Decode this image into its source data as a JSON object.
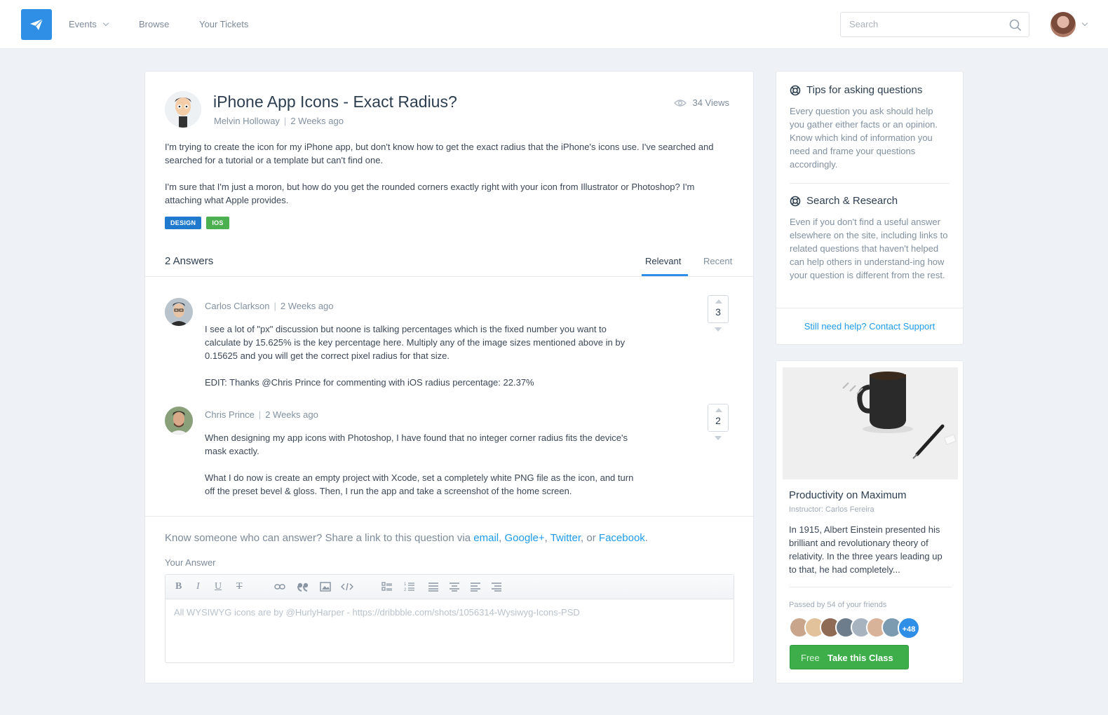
{
  "nav": {
    "events_label": "Events",
    "browse_label": "Browse",
    "tickets_label": "Your Tickets",
    "search_placeholder": "Search"
  },
  "question": {
    "title": "iPhone App Icons - Exact Radius?",
    "author": "Melvin Holloway",
    "time": "2 Weeks ago",
    "views": "34 Views",
    "body": [
      "I'm trying to create the icon for my iPhone app, but don't know how to get the exact radius that the iPhone's icons use. I've searched and searched for a tutorial or a template but can't find one.",
      "I'm sure that I'm just a moron, but how do you get the rounded corners exactly right with your icon from Illustrator or Photoshop? I'm attaching what Apple provides."
    ],
    "tags": [
      "DESIGN",
      "IOS"
    ]
  },
  "answers_section": {
    "count_label": "2 Answers",
    "tabs": [
      "Relevant",
      "Recent"
    ],
    "items": [
      {
        "author": "Carlos Clarkson",
        "time": "2 Weeks ago",
        "votes": "3",
        "body": [
          "I see a lot of \"px\" discussion but noone is talking percentages which is the fixed number you want to calculate by 15.625% is the key percentage here. Multiply any of the image sizes mentioned above in by 0.15625 and you will get the correct pixel radius for that size.",
          "EDIT: Thanks @Chris Prince for commenting with iOS radius percentage: 22.37%"
        ]
      },
      {
        "author": "Chris Prince",
        "time": "2 Weeks ago",
        "votes": "2",
        "body": [
          "When designing my app icons with Photoshop, I have found that no integer corner radius fits the device's mask exactly.",
          "What I do now is create an empty project with Xcode, set a completely white PNG file as the icon, and turn off the preset bevel & gloss. Then, I run the app and take a screenshot of the home screen."
        ]
      }
    ]
  },
  "share": {
    "prefix": "Know someone who can answer? Share a link to this question via",
    "email": "email",
    "comma1": ",",
    "google": "Google+",
    "comma2": ",",
    "twitter": "Twitter",
    "or": ", or",
    "facebook": "Facebook",
    "period": "."
  },
  "editor": {
    "label": "Your Answer",
    "placeholder": "All WYSIWYG icons are by @HurlyHarper - https://dribbble.com/shots/1056314-Wysiwyg-Icons-PSD",
    "tool_bold": "B",
    "tool_italic": "I",
    "tool_underline": "U",
    "tool_strike": "T"
  },
  "tips": {
    "heading1": "Tips for asking questions",
    "text1": "Every question you ask should help you gather either facts or an opinion. Know which kind of information you need and frame your questions accordingly.",
    "heading2": "Search & Research",
    "text2": "Even if you don't find a useful answer elsewhere on the site, including links to related questions that haven't helped can help others in understand-ing how your question is different from the rest.",
    "support_link": "Still need help? Contact Support"
  },
  "course": {
    "title": "Productivity on Maximum",
    "instructor": "Instructor: Carlos Fereira",
    "description": "In 1915, Albert Einstein presented his brilliant and revolutionary theory of relativity. In the three years leading up to that, he had completely...",
    "friends_label": "Passed by 54 of your friends",
    "friends_more": "+48",
    "btn_free": "Free",
    "btn_take": "Take this Class"
  },
  "colors": {
    "accent": "#2f8fe6",
    "link": "#1e9be8",
    "tag_design": "#1f7acd",
    "tag_ios": "#4caf50",
    "cta": "#3dae4a"
  }
}
